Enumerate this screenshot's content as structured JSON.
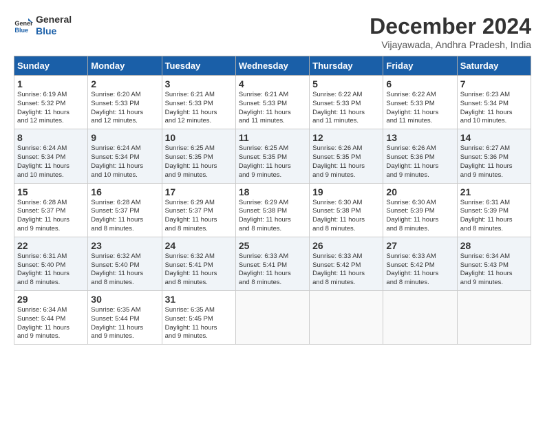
{
  "logo": {
    "line1": "General",
    "line2": "Blue"
  },
  "title": "December 2024",
  "location": "Vijayawada, Andhra Pradesh, India",
  "days_of_week": [
    "Sunday",
    "Monday",
    "Tuesday",
    "Wednesday",
    "Thursday",
    "Friday",
    "Saturday"
  ],
  "weeks": [
    [
      {
        "day": "1",
        "info": "Sunrise: 6:19 AM\nSunset: 5:32 PM\nDaylight: 11 hours\nand 12 minutes."
      },
      {
        "day": "2",
        "info": "Sunrise: 6:20 AM\nSunset: 5:33 PM\nDaylight: 11 hours\nand 12 minutes."
      },
      {
        "day": "3",
        "info": "Sunrise: 6:21 AM\nSunset: 5:33 PM\nDaylight: 11 hours\nand 12 minutes."
      },
      {
        "day": "4",
        "info": "Sunrise: 6:21 AM\nSunset: 5:33 PM\nDaylight: 11 hours\nand 11 minutes."
      },
      {
        "day": "5",
        "info": "Sunrise: 6:22 AM\nSunset: 5:33 PM\nDaylight: 11 hours\nand 11 minutes."
      },
      {
        "day": "6",
        "info": "Sunrise: 6:22 AM\nSunset: 5:33 PM\nDaylight: 11 hours\nand 11 minutes."
      },
      {
        "day": "7",
        "info": "Sunrise: 6:23 AM\nSunset: 5:34 PM\nDaylight: 11 hours\nand 10 minutes."
      }
    ],
    [
      {
        "day": "8",
        "info": "Sunrise: 6:24 AM\nSunset: 5:34 PM\nDaylight: 11 hours\nand 10 minutes."
      },
      {
        "day": "9",
        "info": "Sunrise: 6:24 AM\nSunset: 5:34 PM\nDaylight: 11 hours\nand 10 minutes."
      },
      {
        "day": "10",
        "info": "Sunrise: 6:25 AM\nSunset: 5:35 PM\nDaylight: 11 hours\nand 9 minutes."
      },
      {
        "day": "11",
        "info": "Sunrise: 6:25 AM\nSunset: 5:35 PM\nDaylight: 11 hours\nand 9 minutes."
      },
      {
        "day": "12",
        "info": "Sunrise: 6:26 AM\nSunset: 5:35 PM\nDaylight: 11 hours\nand 9 minutes."
      },
      {
        "day": "13",
        "info": "Sunrise: 6:26 AM\nSunset: 5:36 PM\nDaylight: 11 hours\nand 9 minutes."
      },
      {
        "day": "14",
        "info": "Sunrise: 6:27 AM\nSunset: 5:36 PM\nDaylight: 11 hours\nand 9 minutes."
      }
    ],
    [
      {
        "day": "15",
        "info": "Sunrise: 6:28 AM\nSunset: 5:37 PM\nDaylight: 11 hours\nand 9 minutes."
      },
      {
        "day": "16",
        "info": "Sunrise: 6:28 AM\nSunset: 5:37 PM\nDaylight: 11 hours\nand 8 minutes."
      },
      {
        "day": "17",
        "info": "Sunrise: 6:29 AM\nSunset: 5:37 PM\nDaylight: 11 hours\nand 8 minutes."
      },
      {
        "day": "18",
        "info": "Sunrise: 6:29 AM\nSunset: 5:38 PM\nDaylight: 11 hours\nand 8 minutes."
      },
      {
        "day": "19",
        "info": "Sunrise: 6:30 AM\nSunset: 5:38 PM\nDaylight: 11 hours\nand 8 minutes."
      },
      {
        "day": "20",
        "info": "Sunrise: 6:30 AM\nSunset: 5:39 PM\nDaylight: 11 hours\nand 8 minutes."
      },
      {
        "day": "21",
        "info": "Sunrise: 6:31 AM\nSunset: 5:39 PM\nDaylight: 11 hours\nand 8 minutes."
      }
    ],
    [
      {
        "day": "22",
        "info": "Sunrise: 6:31 AM\nSunset: 5:40 PM\nDaylight: 11 hours\nand 8 minutes."
      },
      {
        "day": "23",
        "info": "Sunrise: 6:32 AM\nSunset: 5:40 PM\nDaylight: 11 hours\nand 8 minutes."
      },
      {
        "day": "24",
        "info": "Sunrise: 6:32 AM\nSunset: 5:41 PM\nDaylight: 11 hours\nand 8 minutes."
      },
      {
        "day": "25",
        "info": "Sunrise: 6:33 AM\nSunset: 5:41 PM\nDaylight: 11 hours\nand 8 minutes."
      },
      {
        "day": "26",
        "info": "Sunrise: 6:33 AM\nSunset: 5:42 PM\nDaylight: 11 hours\nand 8 minutes."
      },
      {
        "day": "27",
        "info": "Sunrise: 6:33 AM\nSunset: 5:42 PM\nDaylight: 11 hours\nand 8 minutes."
      },
      {
        "day": "28",
        "info": "Sunrise: 6:34 AM\nSunset: 5:43 PM\nDaylight: 11 hours\nand 9 minutes."
      }
    ],
    [
      {
        "day": "29",
        "info": "Sunrise: 6:34 AM\nSunset: 5:44 PM\nDaylight: 11 hours\nand 9 minutes."
      },
      {
        "day": "30",
        "info": "Sunrise: 6:35 AM\nSunset: 5:44 PM\nDaylight: 11 hours\nand 9 minutes."
      },
      {
        "day": "31",
        "info": "Sunrise: 6:35 AM\nSunset: 5:45 PM\nDaylight: 11 hours\nand 9 minutes."
      },
      {
        "day": "",
        "info": ""
      },
      {
        "day": "",
        "info": ""
      },
      {
        "day": "",
        "info": ""
      },
      {
        "day": "",
        "info": ""
      }
    ]
  ]
}
